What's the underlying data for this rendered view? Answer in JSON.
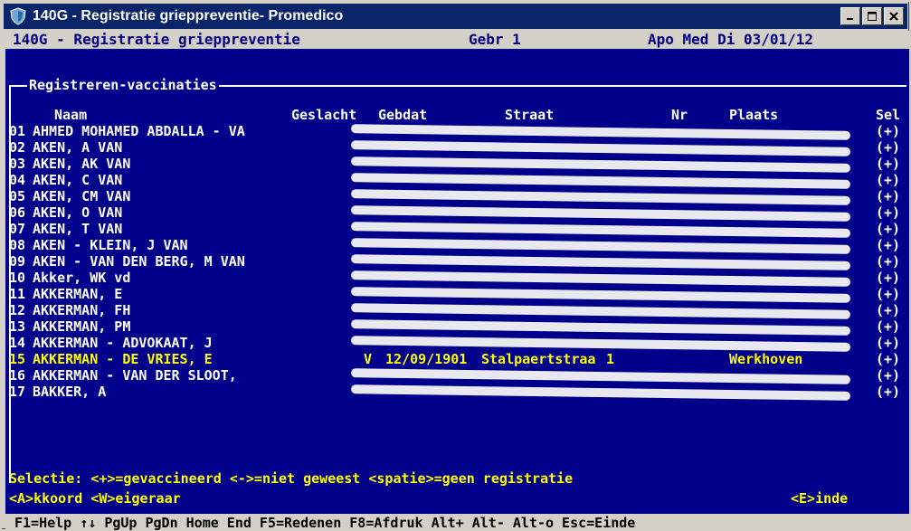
{
  "window": {
    "title": "140G - Registratie griepprevent​ie- Promedico",
    "colors": {
      "titlebar": "#0a246a",
      "console_bg": "#00008b",
      "highlight": "#ffff00"
    }
  },
  "header": {
    "title": "140G - Registratie griepprevent​ie",
    "gebr": "Gebr  1",
    "apo": "Apo Med Di 03/01/12"
  },
  "section": {
    "title": "Registreren-vaccinaties",
    "columns": {
      "naam": "Naam",
      "geslacht": "Geslacht",
      "gebdat": "Gebdat",
      "straat": "Straat",
      "nr": "Nr",
      "plaats": "Plaats",
      "sel": "Sel"
    }
  },
  "rows": [
    {
      "num": "01",
      "name": "AHMED MOHAMED ABDALLA - VA",
      "sel": "(+)"
    },
    {
      "num": "02",
      "name": "AKEN, A VAN",
      "sel": "(+)"
    },
    {
      "num": "03",
      "name": "AKEN, AK VAN",
      "sel": "(+)"
    },
    {
      "num": "04",
      "name": "AKEN, C VAN",
      "sel": "(+)"
    },
    {
      "num": "05",
      "name": "AKEN, CM VAN",
      "sel": "(+)"
    },
    {
      "num": "06",
      "name": "AKEN, O VAN",
      "sel": "(+)"
    },
    {
      "num": "07",
      "name": "AKEN, T VAN",
      "sel": "(+)"
    },
    {
      "num": "08",
      "name": "AKEN - KLEIN, J VAN",
      "sel": "(+)"
    },
    {
      "num": "09",
      "name": "AKEN - VAN DEN BERG, M VAN",
      "sel": "(+)"
    },
    {
      "num": "10",
      "name": "Akker, WK vd",
      "sel": "(+)"
    },
    {
      "num": "11",
      "name": "AKKERMAN, E",
      "sel": "(+)"
    },
    {
      "num": "12",
      "name": "AKKERMAN, FH",
      "sel": "(+)"
    },
    {
      "num": "13",
      "name": "AKKERMAN, PM",
      "sel": "(+)"
    },
    {
      "num": "14",
      "name": "AKKERMAN - ADVOKAAT, J",
      "sel": "(+)"
    },
    {
      "num": "15",
      "name": "AKKERMAN - DE VRIES, E",
      "sel": "(+)",
      "geslacht": "V",
      "gebdat": "12/09/1901",
      "straat": "Stalpaertstraa",
      "nr": "1",
      "plaats": "Werkhoven",
      "highlighted": true
    },
    {
      "num": "16",
      "name": "AKKERMAN - VAN DER SLOOT,",
      "sel": "(+)"
    },
    {
      "num": "17",
      "name": "BAKKER, A",
      "sel": "(+)"
    }
  ],
  "footer": {
    "legend": "Selectie: <+>=gevaccineerd <->=niet geweest   <spatie>=geen registratie",
    "akkoord": "<A>kkoord <W>eigeraar",
    "einde": "<E>inde",
    "fkeys": "F1=Help ↑↓ PgUp PgDn Home End F5=Redenen F8=Afdruk Alt+ Alt- Alt-o   Esc=Einde"
  }
}
